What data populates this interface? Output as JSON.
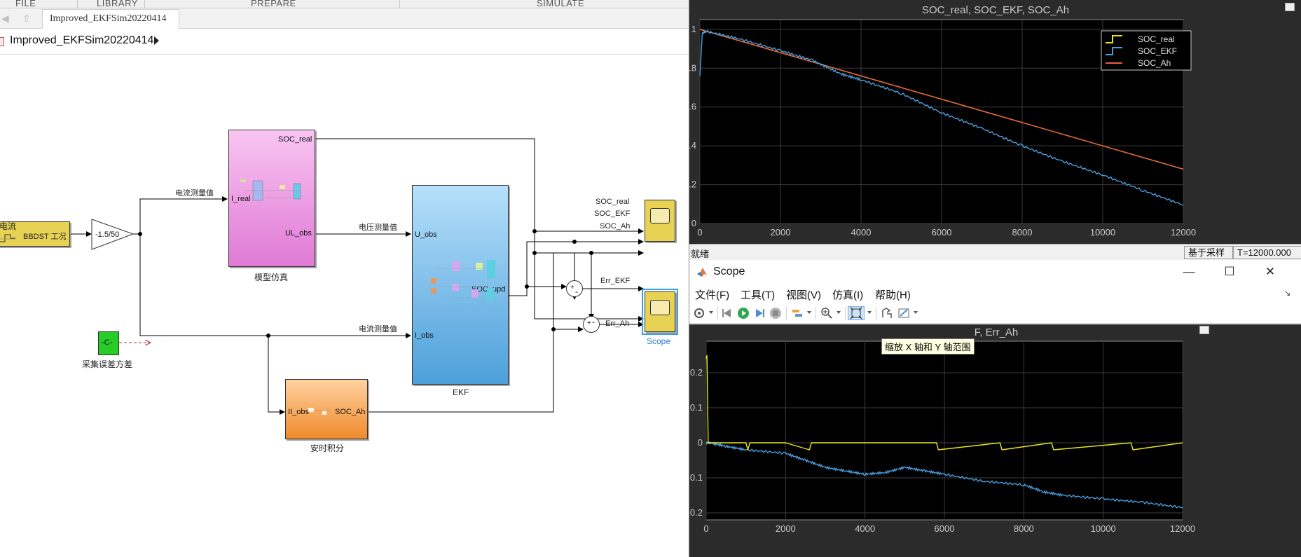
{
  "toolstrip": {
    "sections": [
      "FILE",
      "LIBRARY",
      "PREPARE",
      "SIMULATE"
    ]
  },
  "tab": {
    "label": "Improved_EKFSim20220414"
  },
  "address": {
    "path": "Improved_EKFSim20220414"
  },
  "model": {
    "source_block": {
      "label": "BBDST 工况",
      "top_text": "电流"
    },
    "gain_block": {
      "value": "-1.5/50"
    },
    "model_sim_block": {
      "caption": "模型仿真",
      "in_port": "I_real",
      "out_soc": "SOC_real",
      "out_ul": "UL_obs"
    },
    "ekf_block": {
      "caption": "EKF",
      "in_u": "U_obs",
      "in_i": "I_obs",
      "out": "SOC_upd"
    },
    "ah_block": {
      "caption": "安时积分",
      "in_port": "II_obs",
      "out_port": "SOC_Ah"
    },
    "const_block": {
      "value": "-C-",
      "caption": "采集误差方差"
    },
    "signal_labels": {
      "current_meas_1": "电流测量值",
      "voltage_meas": "电压测量值",
      "current_meas_2": "电流测量值",
      "soc_real": "SOC_real",
      "soc_ekf": "SOC_EKF",
      "soc_ah": "SOC_Ah",
      "err_ekf": "Err_EKF",
      "err_ah": "Err_Ah"
    },
    "sum_signs": {
      "plus": "+",
      "minus": "-"
    },
    "scope_caption": "Scope"
  },
  "scope_top": {
    "title": "SOC_real, SOC_EKF, SOC_Ah",
    "legend": [
      "SOC_real",
      "SOC_EKF",
      "SOC_Ah"
    ],
    "status": {
      "left": "就绪",
      "mode": "基于采样",
      "time": "T=12000.000"
    }
  },
  "scope_bottom": {
    "window_title": "Scope",
    "menu": [
      "文件(F)",
      "工具(T)",
      "视图(V)",
      "仿真(I)",
      "帮助(H)"
    ],
    "tooltip": "缩放 X 轴和 Y 轴范围",
    "title_visible": "F, Err_Ah",
    "controls": {
      "minimize": "—",
      "maximize": "☐",
      "close": "✕"
    }
  },
  "colors": {
    "yellow": "#e6e61e",
    "blue": "#4a9fdf",
    "orange": "#e8603c"
  },
  "chart_data": [
    {
      "type": "line",
      "title": "SOC_real, SOC_EKF, SOC_Ah",
      "xlabel": "",
      "ylabel": "",
      "xlim": [
        0,
        12000
      ],
      "ylim": [
        0,
        1.05
      ],
      "xticks": [
        0,
        2000,
        4000,
        6000,
        8000,
        10000,
        12000
      ],
      "yticks": [
        0,
        0.2,
        0.4,
        0.6,
        0.8,
        1
      ],
      "grid": true,
      "legend_position": "top-right",
      "series": [
        {
          "name": "SOC_real",
          "color": "#e6e61e",
          "x": [
            0,
            12000
          ],
          "y": [
            1.0,
            0.28
          ]
        },
        {
          "name": "SOC_EKF",
          "color": "#4a9fdf",
          "x": [
            0,
            60,
            150,
            1000,
            2000,
            2800,
            3500,
            4000,
            5000,
            6000,
            7000,
            8000,
            9000,
            10000,
            11000,
            12000
          ],
          "y": [
            0.76,
            0.98,
            0.99,
            0.95,
            0.89,
            0.84,
            0.77,
            0.74,
            0.67,
            0.57,
            0.49,
            0.4,
            0.32,
            0.25,
            0.17,
            0.095
          ]
        },
        {
          "name": "SOC_Ah",
          "color": "#e8603c",
          "x": [
            0,
            12000
          ],
          "y": [
            1.0,
            0.28
          ]
        }
      ]
    },
    {
      "type": "line",
      "title": "F, Err_Ah",
      "xlabel": "",
      "ylabel": "",
      "xlim": [
        0,
        12000
      ],
      "ylim": [
        -0.22,
        0.29
      ],
      "xticks": [
        0,
        2000,
        4000,
        6000,
        8000,
        10000,
        12000
      ],
      "yticks": [
        -0.2,
        -0.1,
        0,
        0.1,
        0.2
      ],
      "grid": true,
      "series": [
        {
          "name": "Err_EKF",
          "color": "#e6e61e",
          "x": [
            0,
            20,
            50,
            100,
            1000,
            1050,
            1100,
            2000,
            2600,
            2650,
            5800,
            5850,
            7400,
            7450,
            8700,
            8750,
            10700,
            10750,
            12000
          ],
          "y": [
            0.24,
            0.25,
            0.0,
            0.0,
            0.0,
            -0.02,
            0.0,
            0.0,
            -0.02,
            0.0,
            0.0,
            -0.02,
            0.0,
            -0.02,
            0.0,
            -0.02,
            0.0,
            -0.02,
            0.0
          ]
        },
        {
          "name": "Err_Ah",
          "color": "#4a9fdf",
          "x": [
            0,
            100,
            500,
            1000,
            2000,
            2500,
            3000,
            3500,
            4000,
            4500,
            5000,
            5500,
            6000,
            7000,
            8000,
            8500,
            9000,
            10000,
            11000,
            12000
          ],
          "y": [
            0.0,
            0.0,
            -0.01,
            -0.02,
            -0.03,
            -0.05,
            -0.07,
            -0.08,
            -0.09,
            -0.085,
            -0.07,
            -0.08,
            -0.09,
            -0.11,
            -0.12,
            -0.14,
            -0.15,
            -0.16,
            -0.17,
            -0.185
          ]
        }
      ]
    }
  ]
}
